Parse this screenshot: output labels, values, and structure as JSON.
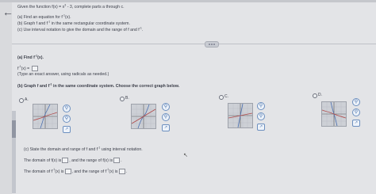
{
  "header": {
    "intro": "Given the function f(x) = x",
    "intro_exp": "3",
    "intro_rest": "- 3, complete parts a through c.",
    "part_a": "(a) Find an equation for f",
    "part_a_exp": "-1",
    "part_a_rest": "(x).",
    "part_b": "(b) Graph f and f",
    "part_b_exp": "-1",
    "part_b_rest": "in the same rectangular coordinate system.",
    "part_c": "(c) Use interval notation to give the domain and the range of f and f",
    "part_c_exp": "-1",
    "part_c_rest": "."
  },
  "answer_a": {
    "title": "(a) Find f",
    "title_exp": "-1",
    "title_rest": "(x).",
    "lhs": "f",
    "lhs_exp": "-1",
    "lhs_rest": "(x) =",
    "hint": "(Type an exact answer, using radicals as needed.)"
  },
  "answer_b": {
    "prompt": "(b) Graph f and f",
    "prompt_exp": "-1",
    "prompt_rest": "in the same coordinate system. Choose the correct graph below.",
    "options": [
      "A.",
      "B.",
      "C.",
      "D."
    ]
  },
  "answer_c": {
    "prompt": "(c) State the domain and range of f and f",
    "prompt_exp": "-1",
    "prompt_rest": "using interval notation.",
    "line1_a": "The domain of f(x) is",
    "line1_b": ", and the range of f(x) is",
    "line1_c": ".",
    "line2_a": "The domain of f",
    "line2_exp": "-1",
    "line2_b": "(x) is",
    "line2_c": ", and the range of f",
    "line2_d": "(x) is",
    "line2_e": "."
  },
  "icons": {
    "back": "arrow-left-icon",
    "zoom": "magnifier-icon",
    "external": "open-in-new-icon"
  },
  "colors": {
    "background": "#d9dadd",
    "accent": "#3d6aa8"
  }
}
